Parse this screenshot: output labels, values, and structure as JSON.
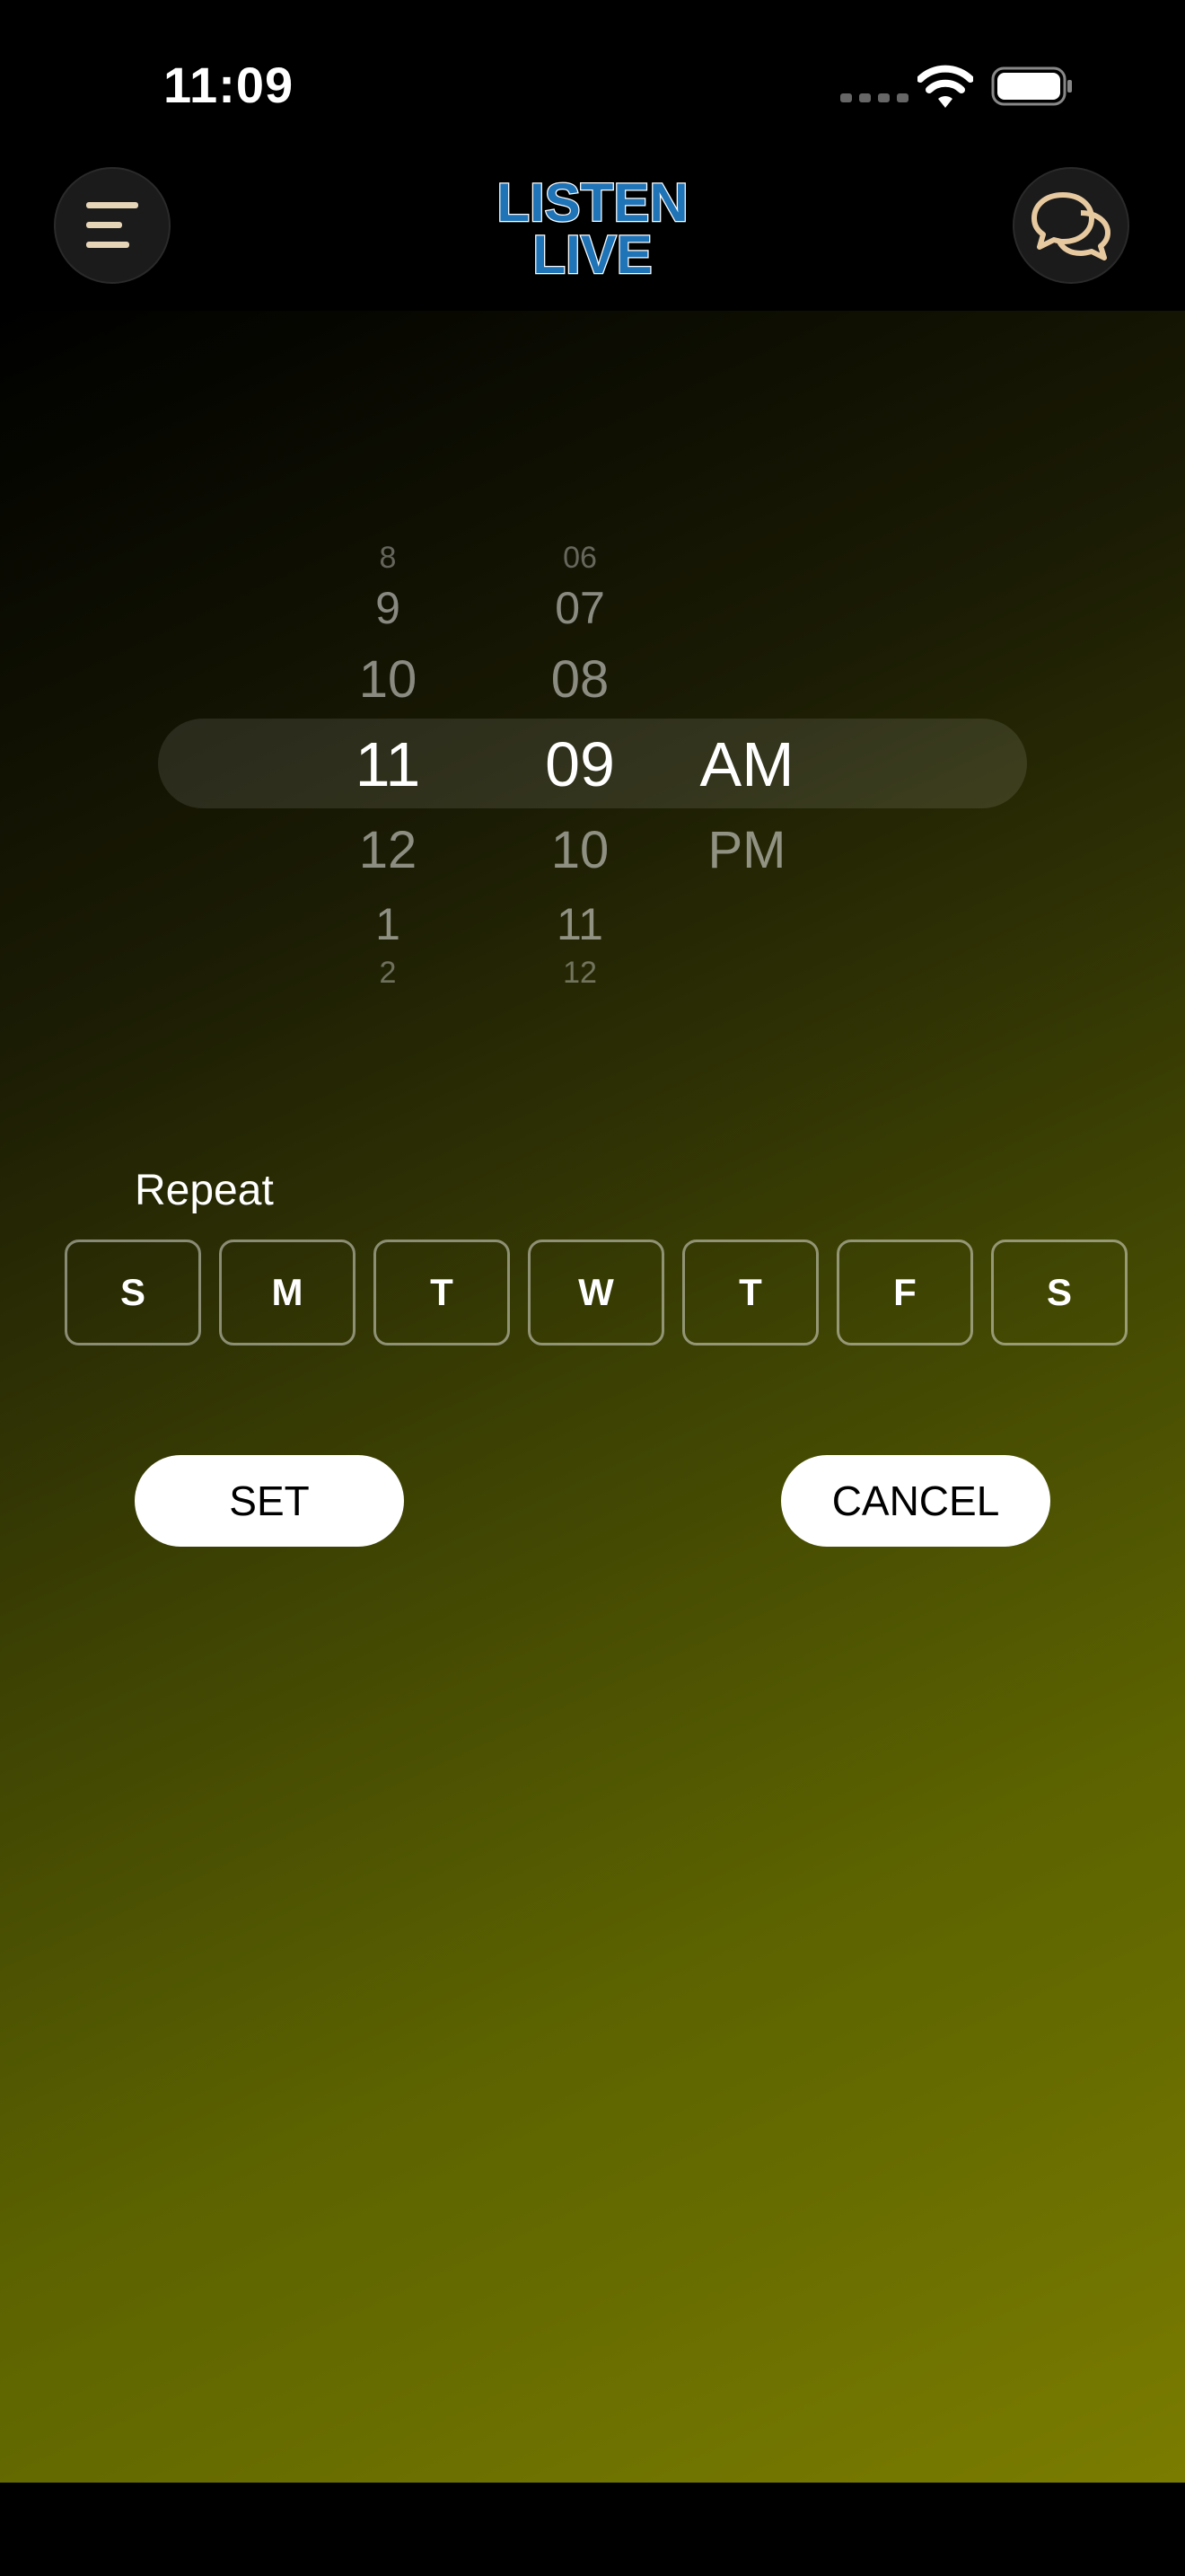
{
  "status_bar": {
    "time": "11:09"
  },
  "header": {
    "logo_line1": "LISTEN",
    "logo_line2": "LIVE",
    "menu_icon": "menu-icon",
    "chat_icon": "chat-bubbles-icon"
  },
  "picker": {
    "hours": [
      "8",
      "9",
      "10",
      "11",
      "12",
      "1",
      "2"
    ],
    "minutes": [
      "06",
      "07",
      "08",
      "09",
      "10",
      "11",
      "12"
    ],
    "selected_hour": "11",
    "selected_minute": "09",
    "periods": [
      "AM",
      "PM"
    ],
    "selected_period": "AM"
  },
  "repeat": {
    "label": "Repeat",
    "days": [
      "S",
      "M",
      "T",
      "W",
      "T",
      "F",
      "S"
    ]
  },
  "actions": {
    "set_label": "SET",
    "cancel_label": "CANCEL"
  },
  "colors": {
    "gradient_end": "#7a7c00",
    "logo_blue": "#1f73b7"
  }
}
